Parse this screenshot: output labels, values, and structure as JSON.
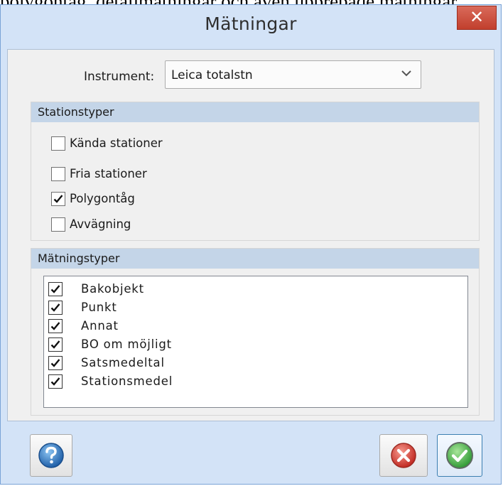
{
  "page_fragment": "polygontåg, detaljmätningar och även upprepade mätningar",
  "dialog": {
    "title": "Mätningar",
    "close_symbol": "✕"
  },
  "instrument": {
    "label": "Instrument:",
    "selected": "Leica totalstn"
  },
  "stationstyper": {
    "header": "Stationstyper",
    "items": [
      {
        "label": "Kända stationer",
        "checked": false
      },
      {
        "label": "Fria stationer",
        "checked": false
      },
      {
        "label": "Polygontåg",
        "checked": true
      },
      {
        "label": "Avvägning",
        "checked": false
      }
    ]
  },
  "matningstyper": {
    "header": "Mätningstyper",
    "items": [
      {
        "label": "Bakobjekt",
        "checked": true
      },
      {
        "label": "Punkt",
        "checked": true
      },
      {
        "label": "Annat",
        "checked": true
      },
      {
        "label": "BO om möjligt",
        "checked": true
      },
      {
        "label": "Satsmedeltal",
        "checked": true
      },
      {
        "label": "Stationsmedel",
        "checked": true
      }
    ]
  },
  "buttons": {
    "help_icon": "help-icon",
    "cancel_icon": "cancel-icon",
    "ok_icon": "ok-icon"
  },
  "colors": {
    "frame": "#d3e3f7",
    "close": "#c7473a",
    "group_header": "#c4d5e8",
    "help_blue": "#2f7cc4",
    "cancel_red": "#d9443c",
    "ok_green": "#4ab54a"
  }
}
